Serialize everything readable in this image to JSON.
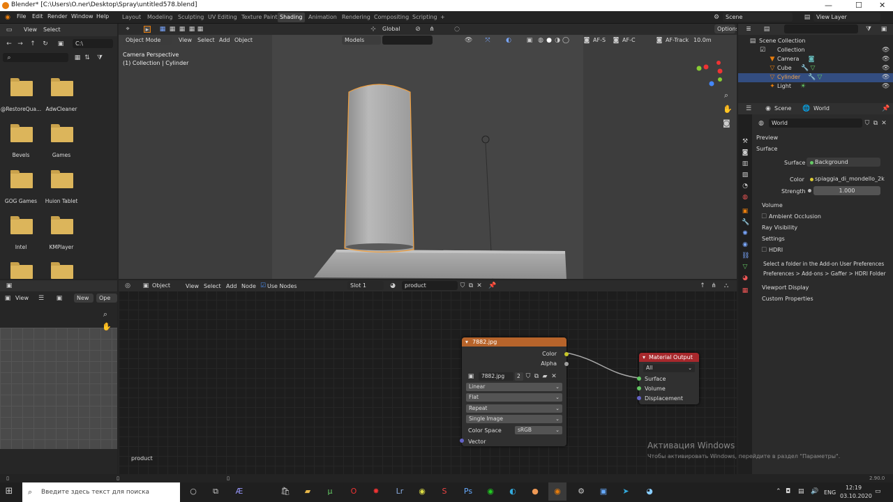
{
  "window": {
    "title": "Blender* [C:\\Users\\O.ner\\Desktop\\Spray\\untitled578.blend]",
    "min": "—",
    "max": "☐",
    "close": "✕"
  },
  "menus": [
    "File",
    "Edit",
    "Render",
    "Window",
    "Help"
  ],
  "workspaces": [
    "Layout",
    "Modeling",
    "Sculpting",
    "UV Editing",
    "Texture Paint",
    "Shading",
    "Animation",
    "Rendering",
    "Compositing",
    "Scripting"
  ],
  "workspace_add": "+",
  "scene": {
    "label": "Scene",
    "view_layer": "View Layer"
  },
  "filebrowser": {
    "view": "View",
    "select": "Select",
    "path": "C:\\",
    "items": [
      "@RestoreQua...",
      "AdwCleaner",
      "Bevels",
      "Games",
      "GOG Games",
      "Huion Tablet",
      "Intel",
      "KMPlayer",
      "",
      ""
    ]
  },
  "viewport": {
    "mode": "Object Mode",
    "menus": [
      "View",
      "Select",
      "Add",
      "Object"
    ],
    "orientation": "Global",
    "overlay_label": "Camera Perspective",
    "overlay_sub": "(1) Collection | Cylinder",
    "options": "Options",
    "models": "Models",
    "af_s": "AF-S",
    "af_c": "AF-C",
    "af_track": "AF-Track",
    "distance": "10.0m"
  },
  "outliner": {
    "root": "Scene Collection",
    "collection": "Collection",
    "items": [
      "Camera",
      "Cube",
      "Cylinder",
      "Light"
    ],
    "selected": "Cylinder"
  },
  "properties": {
    "tabs": [
      "Scene",
      "World"
    ],
    "world_name": "World",
    "sections": [
      "Preview",
      "Surface",
      "Volume",
      "Ambient Occlusion",
      "Ray Visibility",
      "Settings",
      "HDRI",
      "Viewport Display",
      "Custom Properties"
    ],
    "surface_label": "Surface",
    "surface_value": "Background",
    "color_label": "Color",
    "color_value": "spiaggia_di_mondello_2k.h...",
    "strength_label": "Strength",
    "strength_value": "1.000",
    "hdri_msg1": "Select a folder in the Add-on User Preferences",
    "hdri_msg2": "Preferences > Add-ons > Gaffer > HDRI Folder"
  },
  "image_editor": {
    "view": "View",
    "new": "New",
    "open": "Ope"
  },
  "node_editor": {
    "mode": "Object",
    "menus": [
      "View",
      "Select",
      "Add",
      "Node"
    ],
    "use_nodes": "Use Nodes",
    "slot": "Slot 1",
    "material": "product",
    "footer": "product"
  },
  "image_node": {
    "title": "7882.jpg",
    "outputs": [
      "Color",
      "Alpha"
    ],
    "image": "7882.jpg",
    "users": "2",
    "interpolation": "Linear",
    "projection": "Flat",
    "extension": "Repeat",
    "source": "Single Image",
    "colorspace_label": "Color Space",
    "colorspace": "sRGB",
    "input": "Vector"
  },
  "output_node": {
    "title": "Material Output",
    "target": "All",
    "inputs": [
      "Surface",
      "Volume",
      "Displacement"
    ]
  },
  "watermark": {
    "title": "Активация Windows",
    "sub": "Чтобы активировать Windows, перейдите в раздел \"Параметры\"."
  },
  "statusbar": {
    "version": "2.90.0"
  },
  "taskbar": {
    "search": "Введите здесь текст для поиска",
    "lang": "ENG",
    "time": "12:19",
    "date": "03.10.2020"
  },
  "colors": {
    "accent": "#e87d0d",
    "selected_blue": "#334d80",
    "image_header": "#b7642b",
    "output_header": "#a7282c"
  }
}
